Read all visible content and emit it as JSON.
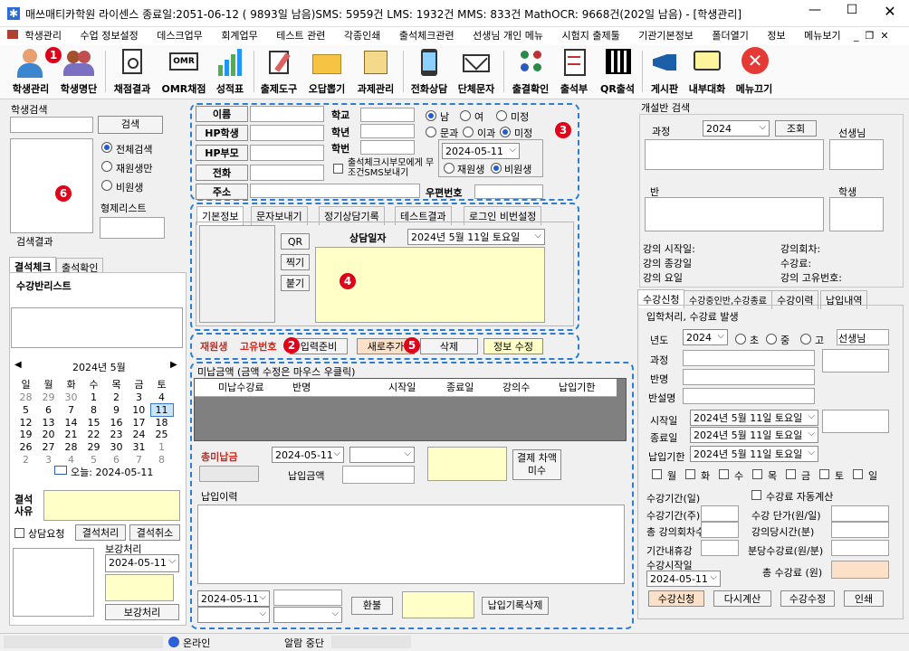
{
  "window": {
    "title": "매쓰매티카학원 라이센스 종료일:2051-06-12 ( 9893일 남음)SMS: 5959건 LMS: 1932건 MMS: 833건 MathOCR: 9668건(202일 남음) - [학생관리]"
  },
  "menu": [
    "학생관리",
    "수업 정보설정",
    "데스크업무",
    "회계업무",
    "테스트 관련",
    "각종인쇄",
    "출석체크관련",
    "선생님 개인 메뉴",
    "시험지 출제툴",
    "기관기본정보",
    "폴더열기",
    "정보",
    "메뉴보기"
  ],
  "toolbar": [
    "학생관리",
    "학생명단",
    "채점결과",
    "OMR채점",
    "성적표",
    "출제도구",
    "오답뽑기",
    "과제관리",
    "전화상담",
    "단체문자",
    "출결확인",
    "출석부",
    "QR출석",
    "게시판",
    "내부대화",
    "메뉴끄기"
  ],
  "badges": [
    "1",
    "2",
    "3",
    "4",
    "5",
    "6"
  ],
  "search": {
    "title": "학생검색",
    "button": "검색",
    "options": [
      "전체검색",
      "재원생만",
      "비원생"
    ],
    "sibling": "형제리스트",
    "result": "검색결과"
  },
  "att_tabs": [
    "결석체크",
    "출석확인"
  ],
  "course_list": "수강반리스트",
  "calendar": {
    "month": "2024년 5월",
    "days": [
      "일",
      "월",
      "화",
      "수",
      "목",
      "금",
      "토"
    ],
    "weeks": [
      [
        "28",
        "29",
        "30",
        "1",
        "2",
        "3",
        "4"
      ],
      [
        "5",
        "6",
        "7",
        "8",
        "9",
        "10",
        "11"
      ],
      [
        "12",
        "13",
        "14",
        "15",
        "16",
        "17",
        "18"
      ],
      [
        "19",
        "20",
        "21",
        "22",
        "23",
        "24",
        "25"
      ],
      [
        "26",
        "27",
        "28",
        "29",
        "30",
        "31",
        "1"
      ],
      [
        "2",
        "3",
        "4",
        "5",
        "6",
        "7",
        "8"
      ]
    ],
    "today": "오늘: 2024-05-11"
  },
  "absence": {
    "reason": "결석 사유",
    "consult": "상담요청",
    "process": "결석처리",
    "cancel": "결석취소",
    "makeup_title": "보강처리",
    "makeup_date": "2024-05-11",
    "makeup_btn": "보강처리"
  },
  "info": {
    "name": "이름",
    "hp_student": "HP학생",
    "hp_parent": "HP부모",
    "phone": "전화",
    "address": "주소",
    "school": "학교",
    "grade": "학년",
    "student_no": "학번",
    "sms_check": "출석체크시부모에게 무조건SMS보내기",
    "postcode": "우편번호",
    "gender": [
      "남",
      "여",
      "미정"
    ],
    "track": [
      "문과",
      "이과",
      "미정"
    ],
    "date": "2024-05-11",
    "status": [
      "재원생",
      "비원생"
    ]
  },
  "detail_tabs": [
    "기본정보",
    "문자보내기",
    "정기상담기록",
    "테스트결과",
    "로그인 비번설정"
  ],
  "detail": {
    "qr": "QR",
    "shoot": "찍기",
    "paste": "붙기",
    "consult_date_label": "상담일자",
    "consult_date": "2024년   5월 11일 토요일"
  },
  "action": {
    "enrolled": "재원생",
    "id_label": "고유번호",
    "ready": "입력준비",
    "new_add": "새로추가",
    "delete": "삭제",
    "edit": "정보 수정"
  },
  "unpaid": {
    "title": "미납금액 (금액 수정은 마우스 우클릭)",
    "cols": [
      "미납수강료",
      "반명",
      "시작일",
      "종료일",
      "강의수",
      "납입기한"
    ],
    "total": "총미납금",
    "date": "2024-05-11",
    "pay_amount": "납입금액",
    "settle": "결제 차액미수",
    "history": "납입이력",
    "date2": "2024-05-11",
    "refund": "환불",
    "del": "납입기록삭제"
  },
  "class_search": {
    "title": "개설반 검색",
    "course": "과정",
    "year": "2024",
    "lookup": "조회",
    "teacher": "선생님",
    "class": "반",
    "student": "학생",
    "start_date": "강의 시작일:",
    "end_date": "강의 종강일",
    "weekday": "강의 요일",
    "sessions": "강의회차:",
    "fee": "수강료:",
    "class_id": "강의 고유번호:"
  },
  "enroll_tabs": [
    "수강신청",
    "수강중인반,수강종료",
    "수강이력",
    "납입내역"
  ],
  "enroll": {
    "title": "입학처리, 수강료 발생",
    "year_label": "년도",
    "year": "2024",
    "levels": [
      "초",
      "중",
      "고"
    ],
    "teacher": "선생님",
    "course": "과정",
    "class_name": "반명",
    "class_schedule": "반설명",
    "start_label": "시작일",
    "start": "2024년   5월 11일 토요일",
    "end_label": "종료일",
    "end": "2024년   5월 11일 토요일",
    "due_label": "납입기한",
    "due": "2024년   5월 11일 토요일",
    "weekdays": [
      "월",
      "화",
      "수",
      "목",
      "금",
      "토",
      "일"
    ],
    "period": "수강기간(일)",
    "auto_calc": "수강료 자동계산",
    "period_w": "수강기간(주)",
    "unit_price": "수강 단가(원/일)",
    "total_sessions": "총 강의회차수",
    "session_min": "강의당시간(분)",
    "holiday": "기간내휴강",
    "per_min": "분당수강료(원/분)",
    "start_day": "수강시작일",
    "start_day_val": "2024-05-11",
    "total_fee": "총 수강료 (원)",
    "btn_enroll": "수강신청",
    "btn_recalc": "다시계산",
    "btn_edit": "수강수정",
    "btn_print": "인쇄"
  },
  "status": {
    "online": "온라인",
    "alarm": "알람 중단"
  },
  "colors": {
    "dash": "#2c7fd0",
    "badge": "#e0001a",
    "yellow": "#ffffc8",
    "accent_red": "#d0281c"
  }
}
